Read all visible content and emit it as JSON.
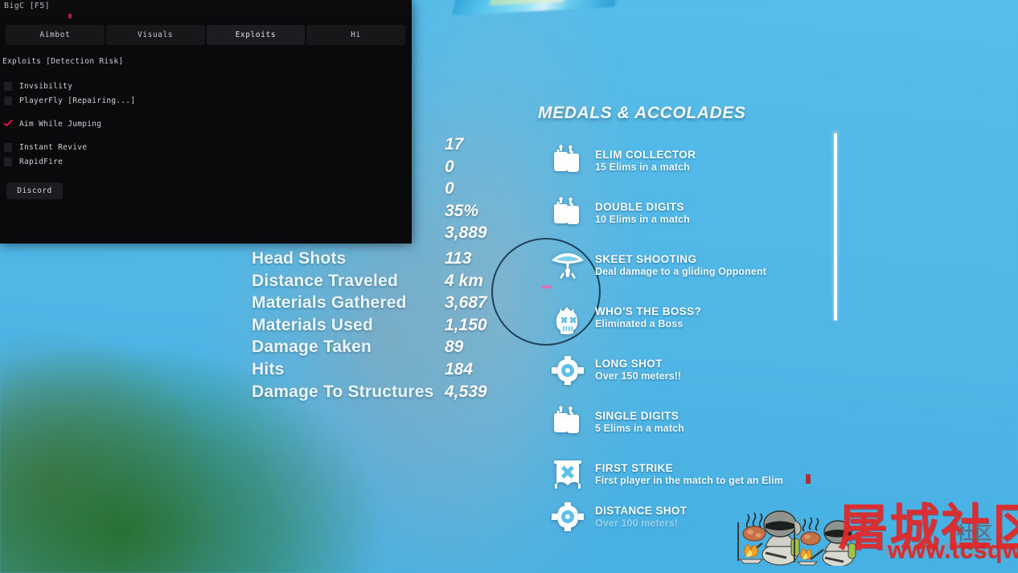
{
  "cheat_menu": {
    "title": "BigC [F5]",
    "tabs": [
      {
        "label": "Aimbot",
        "active": false
      },
      {
        "label": "Visuals",
        "active": false
      },
      {
        "label": "Exploits",
        "active": true
      },
      {
        "label": "Hi",
        "active": false
      }
    ],
    "section_header": "Exploits [Detection Risk]",
    "options": [
      {
        "label": "Invsibility",
        "checked": false
      },
      {
        "label": "PlayerFly [Repairing...]",
        "checked": false
      },
      {
        "label": "Aim While Jumping",
        "checked": true
      },
      {
        "label": "Instant Revive",
        "checked": false
      },
      {
        "label": "RapidFire",
        "checked": false
      }
    ],
    "discord_button": "Discord",
    "accent_color": "#e0124f",
    "background_color": "#0a0a0c"
  },
  "match_stats": {
    "hidden_values": [
      "17",
      "0",
      "0",
      "35%",
      "3,889"
    ],
    "rows": [
      {
        "label": "Head Shots",
        "value": "113"
      },
      {
        "label": "Distance Traveled",
        "value": "4 km"
      },
      {
        "label": "Materials Gathered",
        "value": "3,687"
      },
      {
        "label": "Materials Used",
        "value": "1,150"
      },
      {
        "label": "Damage Taken",
        "value": "89"
      },
      {
        "label": "Hits",
        "value": "184"
      },
      {
        "label": "Damage To Structures",
        "value": "4,539"
      }
    ]
  },
  "medals_panel": {
    "title": "MEDALS & ACCOLADES",
    "items": [
      {
        "name": "ELIM COLLECTOR",
        "desc": "15 Elims in a match",
        "icon": "dogtags-icon"
      },
      {
        "name": "DOUBLE DIGITS",
        "desc": "10 Elims in a match",
        "icon": "dogtags-icon"
      },
      {
        "name": "SKEET SHOOTING",
        "desc": "Deal damage to a gliding Opponent",
        "icon": "glider-icon"
      },
      {
        "name": "WHO'S THE BOSS?",
        "desc": "Eliminated a Boss",
        "icon": "skull-crown-icon"
      },
      {
        "name": "LONG SHOT",
        "desc": "Over 150 meters!!",
        "icon": "crosshair-icon"
      },
      {
        "name": "SINGLE DIGITS",
        "desc": "5 Elims in a match",
        "icon": "dogtags-icon"
      },
      {
        "name": "FIRST STRIKE",
        "desc": "First player in the match to get an Elim",
        "icon": "banner-x-icon"
      },
      {
        "name": "DISTANCE SHOT",
        "desc": "Over 100 meters!",
        "icon": "crosshair-icon"
      }
    ]
  },
  "watermark": {
    "cn_text": "屠城社区",
    "cn_text_small": "社区",
    "url": "www.tcsqw.com",
    "color": "#e42525"
  }
}
